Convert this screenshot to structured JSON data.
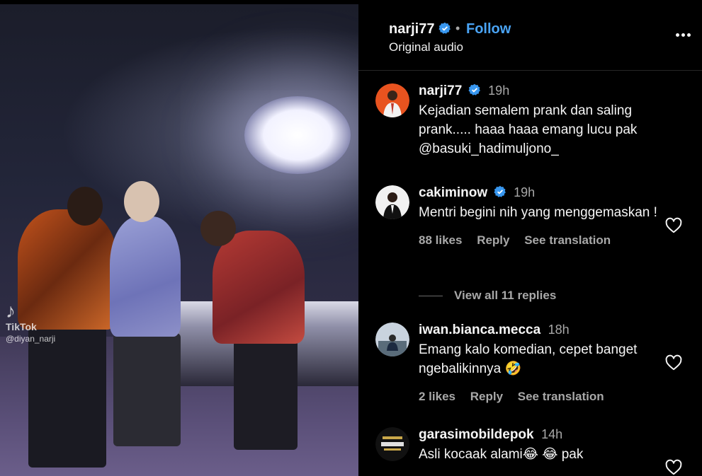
{
  "video": {
    "watermark_brand": "TikTok",
    "watermark_user": "@diyan_narji"
  },
  "header": {
    "username": "narji77",
    "separator": "•",
    "follow_label": "Follow",
    "audio_label": "Original audio"
  },
  "comments": [
    {
      "username": "narji77",
      "time": "19h",
      "text": "Kejadian semalem prank dan saling prank..... haaa haaa emang lucu pak @basuki_hadimuljono_"
    },
    {
      "username": "cakiminow",
      "time": "19h",
      "text": "Mentri begini nih yang menggemaskan !",
      "likes": "88 likes",
      "reply_label": "Reply",
      "translate_label": "See translation"
    },
    {
      "username": "iwan.bianca.mecca",
      "time": "18h",
      "text": "Emang kalo komedian, cepet banget ngebalikinnya 🤣",
      "likes": "2 likes",
      "reply_label": "Reply",
      "translate_label": "See translation"
    },
    {
      "username": "garasimobildepok",
      "time": "14h",
      "text": "Asli kocaak alami😂 😂  pak"
    }
  ],
  "view_replies": "View all 11 replies",
  "colors": {
    "accent": "#4aa4f5",
    "verified": "#3897f0",
    "muted": "#a8a8a8"
  }
}
